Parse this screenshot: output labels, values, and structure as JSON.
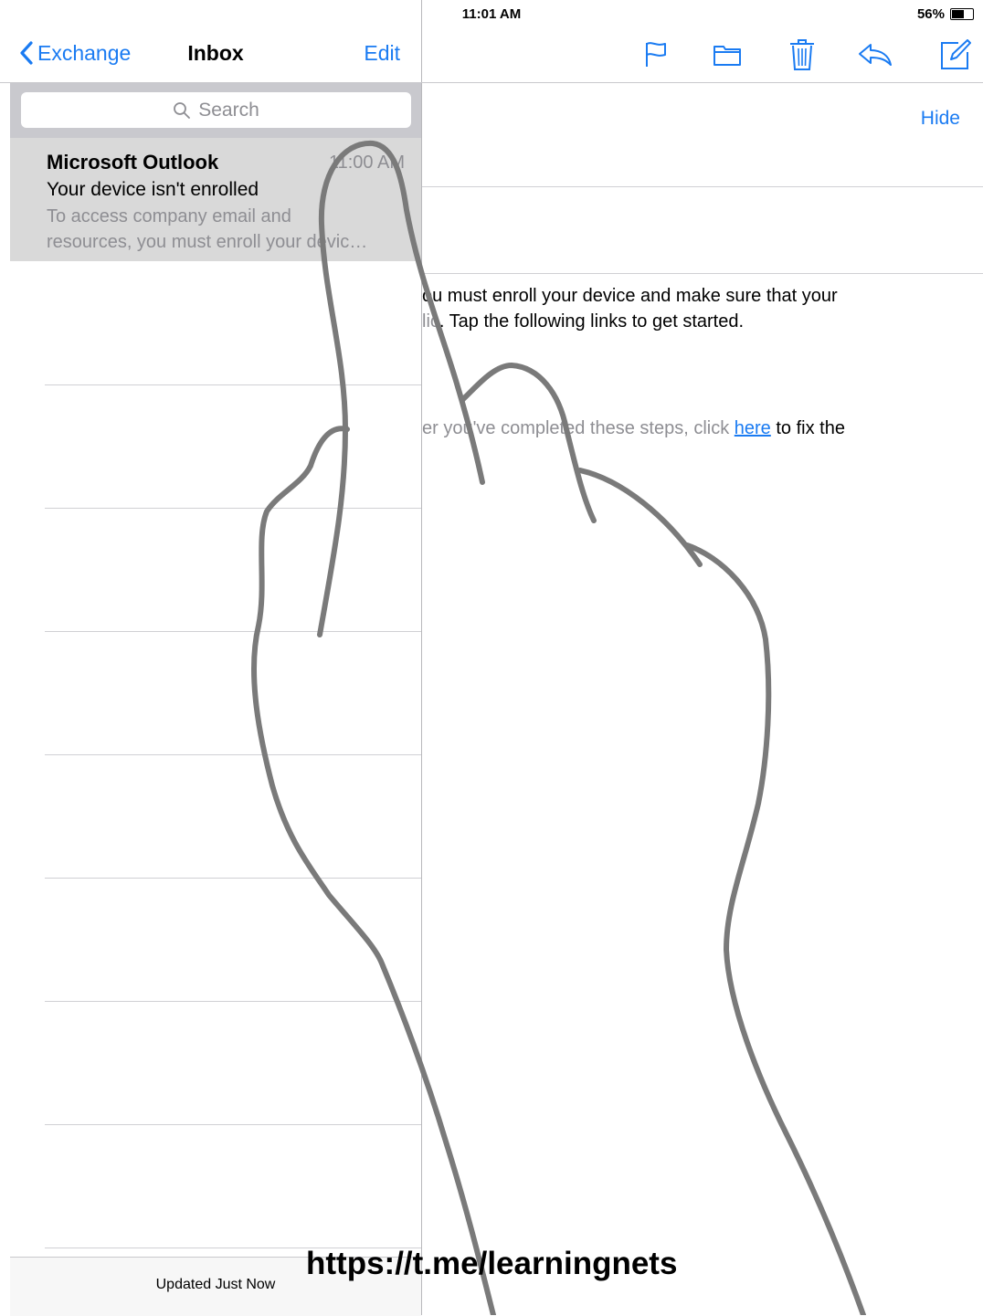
{
  "status_bar": {
    "device": "iPad",
    "time": "11:01 AM",
    "battery": "56%"
  },
  "nav": {
    "back_label": "Exchange",
    "title": "Inbox",
    "edit_label": "Edit"
  },
  "search": {
    "placeholder": "Search"
  },
  "message": {
    "sender": "Microsoft Outlook",
    "time": "11:00 AM",
    "subject": "Your device isn't enrolled",
    "preview_line1": "To access company email and",
    "preview_line2": "resources, you must enroll your devic…"
  },
  "footer": {
    "status": "Updated Just Now"
  },
  "toolbar": {
    "icons": [
      "flag-icon",
      "folder-icon",
      "trash-icon",
      "reply-icon",
      "compose-icon"
    ]
  },
  "detail": {
    "hide_label": "Hide",
    "line1": "ou must enroll your device and make sure that your",
    "line2_pre": "lic",
    "line2": ". Tap the following links to get started.",
    "line3_pre": "er you've completed these steps, click ",
    "line3_link": "here",
    "line3_post": " to fix the"
  },
  "watermark": "https://t.me/learningnets",
  "colors": {
    "accent": "#1a7bf2",
    "hand_stroke": "#7a7a7a",
    "selected_row": "#d9d9d9",
    "search_bar": "#c9c9ce"
  }
}
